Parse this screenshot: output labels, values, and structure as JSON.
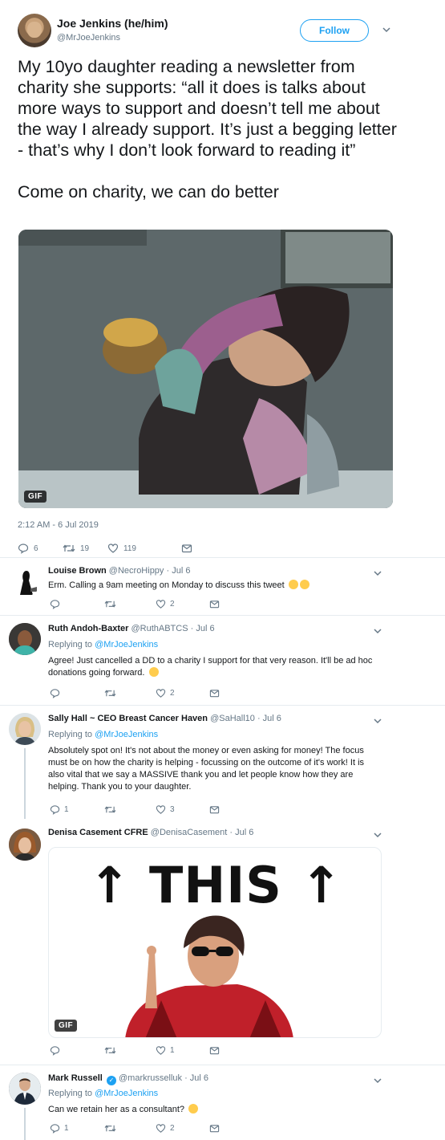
{
  "tweet": {
    "author_name": "Joe Jenkins (he/him)",
    "author_handle": "@MrJoeJenkins",
    "follow_label": "Follow",
    "text": "My 10yo daughter reading a newsletter from charity she supports: “all it does is talks about more ways to support and doesn’t tell me about the way I already support. It’s just a begging letter - that’s why I don’t look forward to reading it”\n\nCome on charity, we can do better",
    "media_badge": "GIF",
    "timestamp": "2:12 AM - 6 Jul 2019",
    "reply_count": "6",
    "retweet_count": "19",
    "like_count": "119"
  },
  "replies": [
    {
      "name": "Louise Brown",
      "handle": "@NecroHippy",
      "date": "· Jul 6",
      "text": "Erm. Calling a 9am meeting on Monday to discuss this tweet",
      "reply_count": "",
      "retweet_count": "",
      "like_count": "2"
    },
    {
      "name": "Ruth Andoh-Baxter",
      "handle": "@RuthABTCS",
      "date": "· Jul 6",
      "replying_prefix": "Replying to",
      "replying_to": "@MrJoeJenkins",
      "text": "Agree! Just cancelled a DD to a charity I support for that very reason.  It'll be ad hoc donations going forward.",
      "reply_count": "",
      "retweet_count": "",
      "like_count": "2"
    },
    {
      "name": "Sally Hall ~ CEO Breast Cancer Haven",
      "handle": "@SaHall10",
      "date": "· Jul 6",
      "replying_prefix": "Replying to",
      "replying_to": "@MrJoeJenkins",
      "text": "Absolutely spot on! It's not about the money or even asking for money! The focus must be on how the charity is helping - focussing on the outcome of it's work! It is also vital that we say a MASSIVE thank you and let people know how they are helping. Thank you to your daughter.",
      "reply_count": "1",
      "retweet_count": "",
      "like_count": "3"
    },
    {
      "name": "Denisa Casement CFRE",
      "handle": "@DenisaCasement",
      "date": "· Jul 6",
      "media_text": "↑ THIS ↑",
      "media_badge": "GIF",
      "reply_count": "",
      "retweet_count": "",
      "like_count": "1"
    },
    {
      "name": "Mark Russell",
      "handle": "@markrusselluk",
      "date": "· Jul 6",
      "replying_prefix": "Replying to",
      "replying_to": "@MrJoeJenkins",
      "text": "Can we retain her as a consultant?",
      "reply_count": "1",
      "retweet_count": "",
      "like_count": "2"
    }
  ],
  "colors": {
    "accent": "#1da1f2",
    "text": "#14171a",
    "muted": "#657786",
    "divider": "#e6ecf0"
  }
}
